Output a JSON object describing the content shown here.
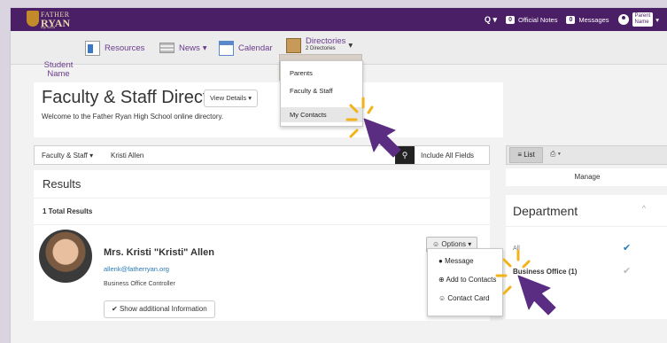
{
  "topbar": {
    "logo": {
      "line1": "FATHER",
      "line2": "RYAN",
      "line3": "High School"
    },
    "search_label": "Q ▾",
    "official_notes_count": "0",
    "official_notes_label": "Official Notes",
    "messages_count": "0",
    "messages_label": "Messages",
    "parent_name_line1": "Parent",
    "parent_name_line2": "Name"
  },
  "nav": {
    "student_name": "Student Name",
    "resources": "Resources",
    "news": "News",
    "calendar": "Calendar",
    "directories": "Directories",
    "directories_sub": "2 Directories"
  },
  "directories_menu": {
    "parents": "Parents",
    "faculty_staff": "Faculty & Staff",
    "my_contacts": "My Contacts"
  },
  "header": {
    "title": "Faculty & Staff Directory",
    "subtitle": "Welcome to the Father Ryan High School online directory.",
    "view_details": "View Details"
  },
  "search": {
    "type": "Faculty & Staff",
    "query": "Kristi Allen",
    "include_all": "Include All Fields"
  },
  "results": {
    "title": "Results",
    "total": "1 Total Results",
    "person": {
      "name": "Mrs. Kristi \"Kristi\" Allen",
      "email": "allenk@fatherryan.org",
      "job_title": "Business Office Controller"
    },
    "show_more": "Show additional Information",
    "options": "Options"
  },
  "options_menu": {
    "message": "Message",
    "add_contacts": "Add to Contacts",
    "contact_card": "Contact Card"
  },
  "right_panel": {
    "list": "List",
    "manage": "Manage",
    "department_title": "Department",
    "all": "All",
    "business_office": "Business Office (1)"
  },
  "colors": {
    "accent": "#4a1f66",
    "arrow": "#5a2d82",
    "sparkle": "#f2b31a"
  }
}
